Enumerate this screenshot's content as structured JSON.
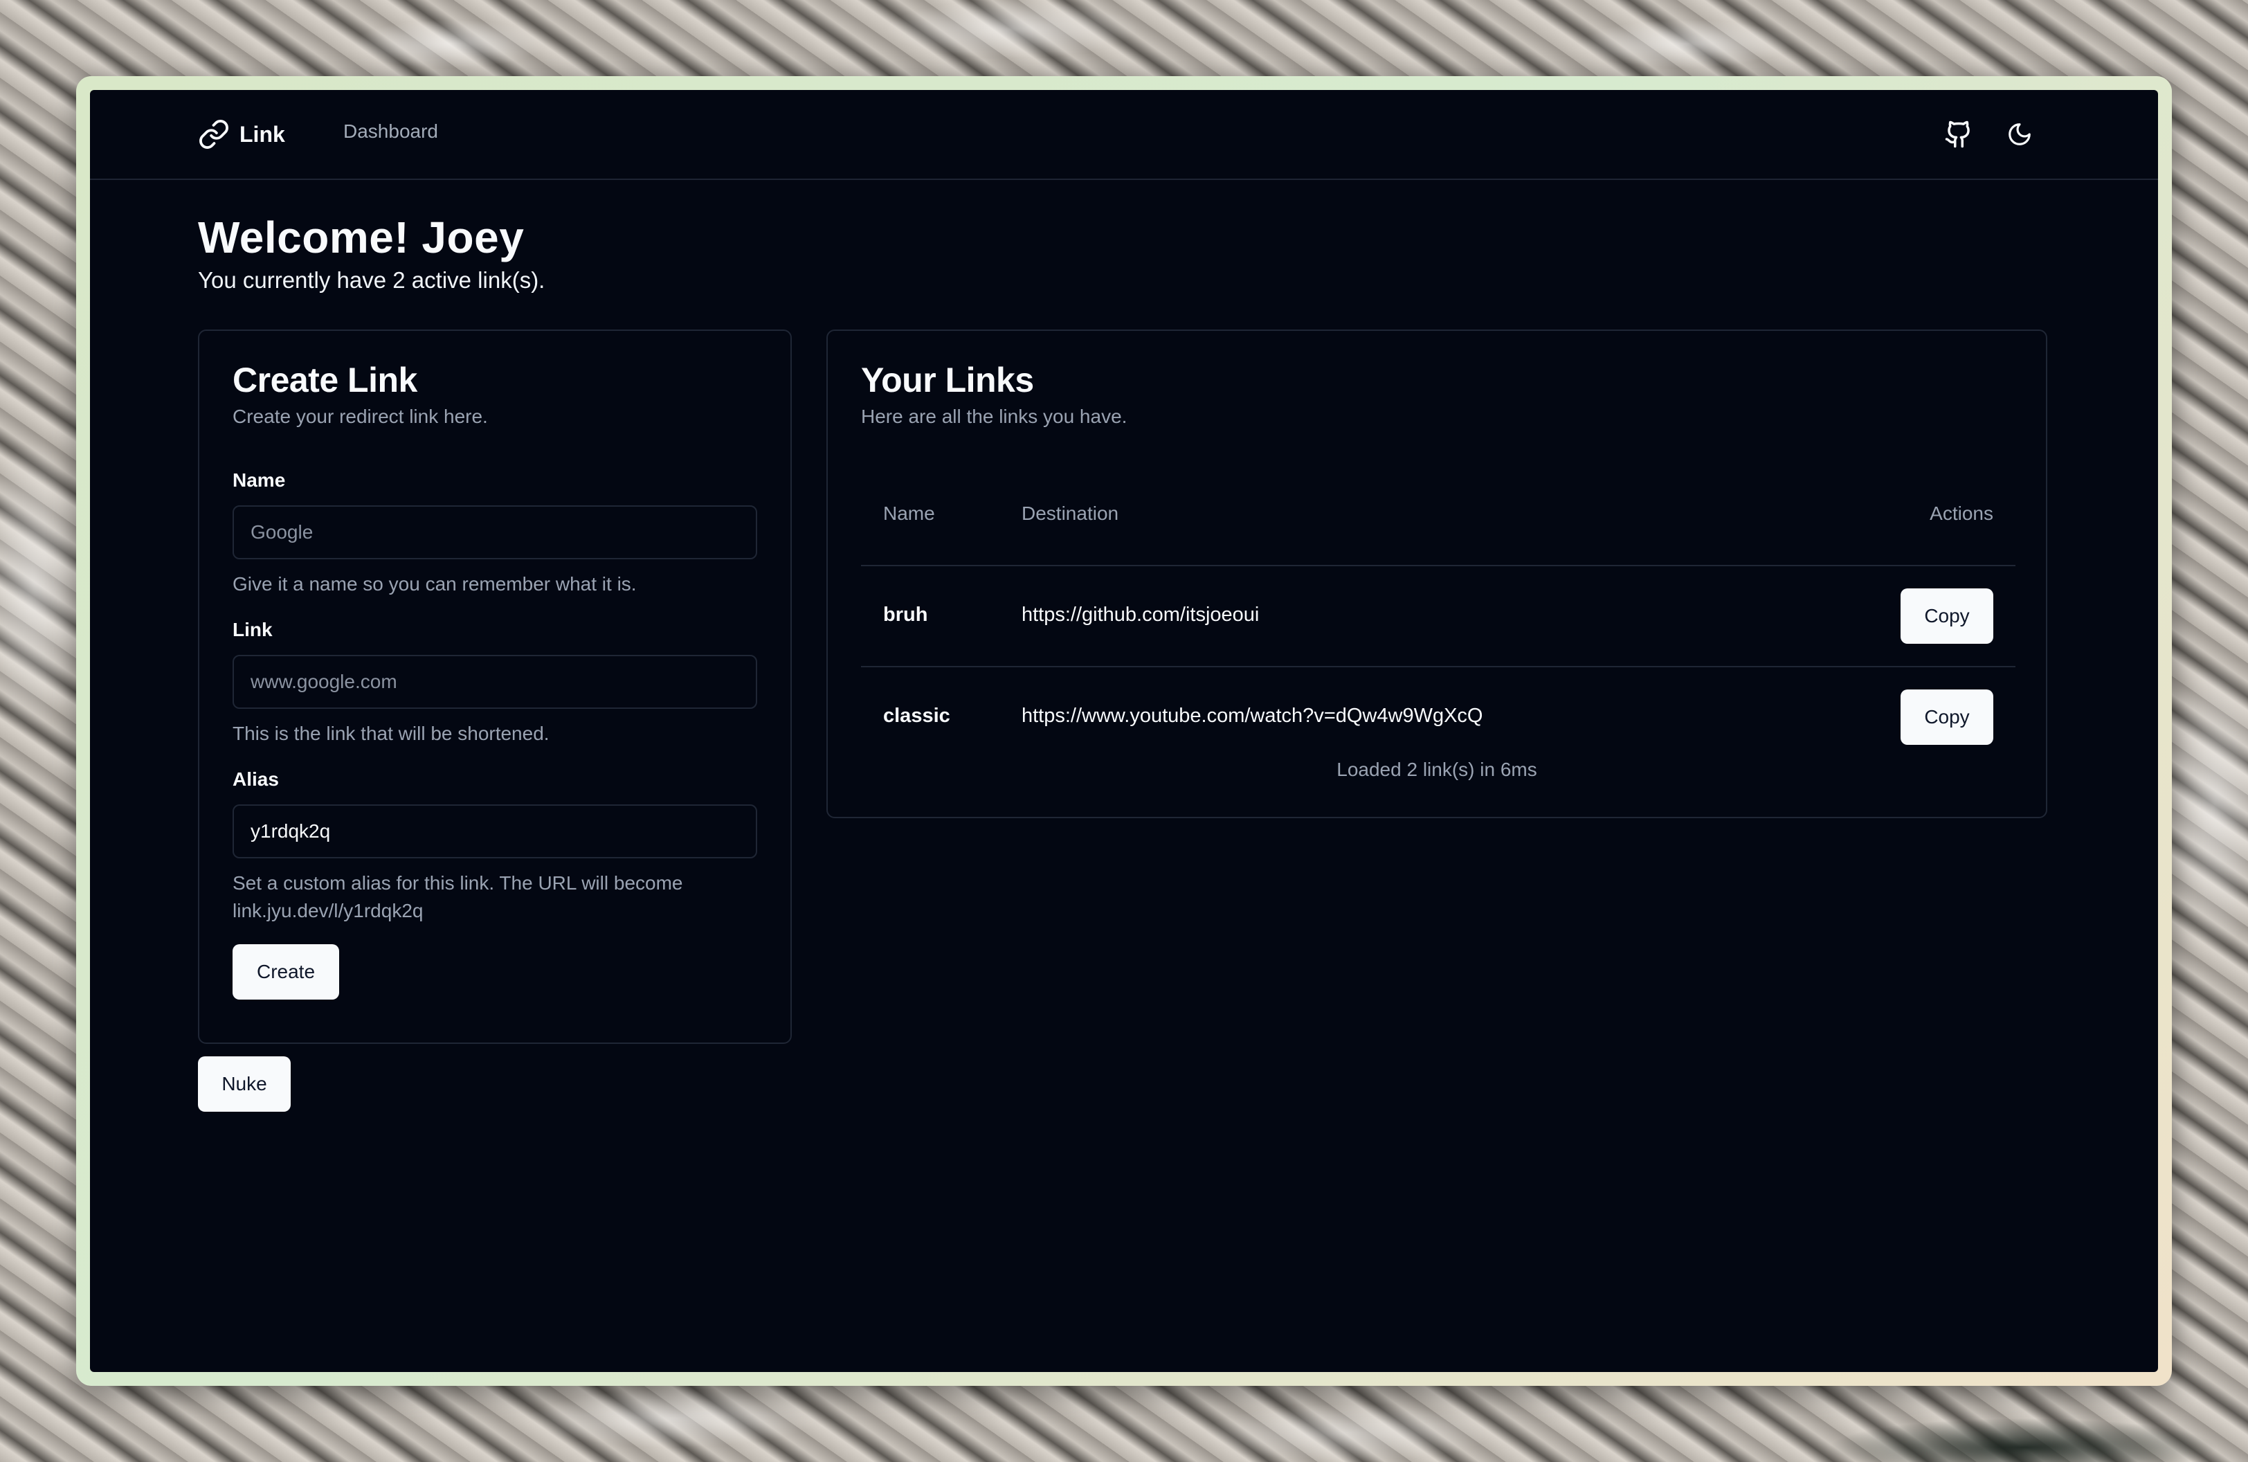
{
  "nav": {
    "brand": "Link",
    "dashboard": "Dashboard",
    "icons": [
      "link-icon",
      "github-icon",
      "moon-icon"
    ]
  },
  "welcome": {
    "title": "Welcome! Joey",
    "subtitle": "You currently have 2 active link(s)."
  },
  "create": {
    "title": "Create Link",
    "description": "Create your redirect link here.",
    "name_label": "Name",
    "name_placeholder": "Google",
    "name_help": "Give it a name so you can remember what it is.",
    "link_label": "Link",
    "link_placeholder": "www.google.com",
    "link_help": "This is the link that will be shortened.",
    "alias_label": "Alias",
    "alias_value": "y1rdqk2q",
    "alias_help": "Set a custom alias for this link. The URL will become link.jyu.dev/l/y1rdqk2q",
    "create_button": "Create"
  },
  "nuke_button": "Nuke",
  "links": {
    "title": "Your Links",
    "description": "Here are all the links you have.",
    "columns": {
      "name": "Name",
      "destination": "Destination",
      "actions": "Actions"
    },
    "rows": [
      {
        "name": "bruh",
        "destination": "https://github.com/itsjoeoui",
        "action": "Copy"
      },
      {
        "name": "classic",
        "destination": "https://www.youtube.com/watch?v=dQw4w9WgXcQ",
        "action": "Copy"
      }
    ],
    "caption": "Loaded 2 link(s) in 6ms"
  },
  "colors": {
    "background": "#030712",
    "border": "#1f2635",
    "text": "#f8fafc",
    "muted": "#9aa3b2",
    "button_bg": "#f8fafc",
    "button_text": "#0f172a"
  }
}
